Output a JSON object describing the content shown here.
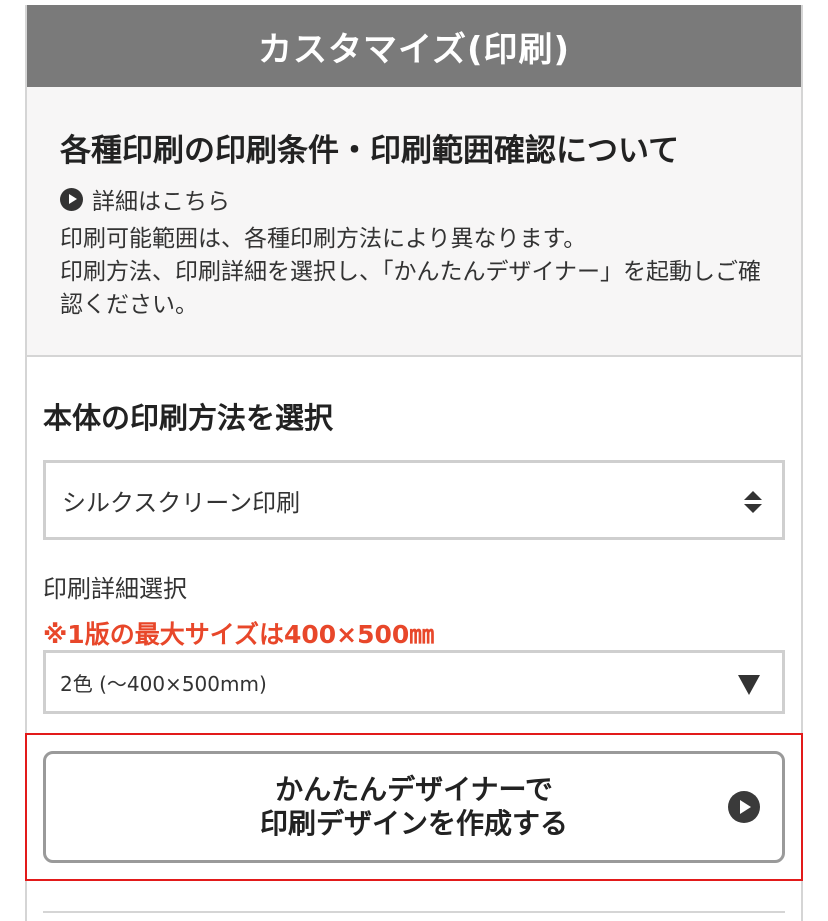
{
  "header": {
    "title": "カスタマイズ(印刷)",
    "bg_color": "#7a7a7a"
  },
  "info": {
    "title": "各種印刷の印刷条件・印刷範囲確認について",
    "detail_link": "詳細はこちら",
    "detail_icon": "play-circle-icon",
    "lines": [
      "印刷可能範囲は、各種印刷方法により異なります。",
      "印刷方法、印刷詳細を選択し、「かんたんデザイナー」を起動しご確認ください。"
    ]
  },
  "method": {
    "title": "本体の印刷方法を選択",
    "selected": "シルクスクリーン印刷",
    "icon": "updown-arrows-icon"
  },
  "detail": {
    "label": "印刷詳細選択",
    "note": "※1版の最大サイズは400×500㎜",
    "note_color": "#e8472a",
    "selected": "2色 (〜400×500mm)",
    "icon": "triangle-down-icon"
  },
  "cta": {
    "line1": "かんたんデザイナーで",
    "line2": "印刷デザインを作成する",
    "icon": "play-circle-icon",
    "highlight_color": "#e21a1a"
  }
}
